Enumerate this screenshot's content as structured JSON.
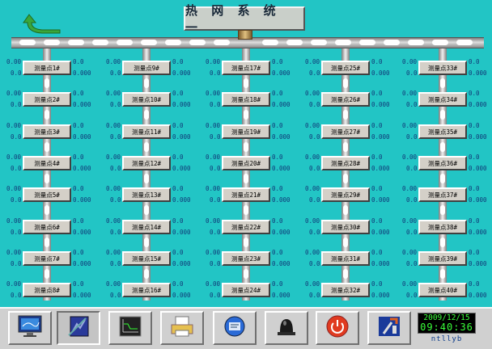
{
  "title": "热 网 系 统 一",
  "points": [
    {
      "label": "测量点1#",
      "tl": "0.00",
      "bl": "0.0",
      "tr": "0.0",
      "br": "0.000"
    },
    {
      "label": "测量点2#",
      "tl": "0.00",
      "bl": "0.0",
      "tr": "0.0",
      "br": "0.000"
    },
    {
      "label": "测量点3#",
      "tl": "0.00",
      "bl": "0.0",
      "tr": "0.0",
      "br": "0.000"
    },
    {
      "label": "测量点4#",
      "tl": "0.00",
      "bl": "0.0",
      "tr": "0.0",
      "br": "0.000"
    },
    {
      "label": "测量点5#",
      "tl": "0.00",
      "bl": "0.0",
      "tr": "0.0",
      "br": "0.000"
    },
    {
      "label": "测量点6#",
      "tl": "0.00",
      "bl": "0.0",
      "tr": "0.0",
      "br": "0.000"
    },
    {
      "label": "测量点7#",
      "tl": "0.00",
      "bl": "0.0",
      "tr": "0.0",
      "br": "0.000"
    },
    {
      "label": "测量点8#",
      "tl": "0.00",
      "bl": "0.0",
      "tr": "0.0",
      "br": "0.000"
    },
    {
      "label": "测量点9#",
      "tl": "0.00",
      "bl": "0.0",
      "tr": "0.0",
      "br": "0.000"
    },
    {
      "label": "测量点10#",
      "tl": "0.00",
      "bl": "0.0",
      "tr": "0.0",
      "br": "0.000"
    },
    {
      "label": "测量点11#",
      "tl": "0.00",
      "bl": "0.0",
      "tr": "0.0",
      "br": "0.000"
    },
    {
      "label": "测量点12#",
      "tl": "0.00",
      "bl": "0.0",
      "tr": "0.0",
      "br": "0.000"
    },
    {
      "label": "测量点13#",
      "tl": "0.00",
      "bl": "0.0",
      "tr": "0.0",
      "br": "0.000"
    },
    {
      "label": "测量点14#",
      "tl": "0.00",
      "bl": "0.0",
      "tr": "0.0",
      "br": "0.000"
    },
    {
      "label": "测量点15#",
      "tl": "0.00",
      "bl": "0.0",
      "tr": "0.0",
      "br": "0.000"
    },
    {
      "label": "测量点16#",
      "tl": "0.00",
      "bl": "0.0",
      "tr": "0.0",
      "br": "0.000"
    },
    {
      "label": "测量点17#",
      "tl": "0.00",
      "bl": "0.0",
      "tr": "0.0",
      "br": "0.000"
    },
    {
      "label": "测量点18#",
      "tl": "0.00",
      "bl": "0.0",
      "tr": "0.0",
      "br": "0.000"
    },
    {
      "label": "测量点19#",
      "tl": "0.00",
      "bl": "0.0",
      "tr": "0.0",
      "br": "0.000"
    },
    {
      "label": "测量点20#",
      "tl": "0.00",
      "bl": "0.0",
      "tr": "0.0",
      "br": "0.000"
    },
    {
      "label": "测量点21#",
      "tl": "0.00",
      "bl": "0.0",
      "tr": "0.0",
      "br": "0.000"
    },
    {
      "label": "测量点22#",
      "tl": "0.00",
      "bl": "0.0",
      "tr": "0.0",
      "br": "0.000"
    },
    {
      "label": "测量点23#",
      "tl": "0.00",
      "bl": "0.0",
      "tr": "0.0",
      "br": "0.000"
    },
    {
      "label": "测量点24#",
      "tl": "0.00",
      "bl": "0.0",
      "tr": "0.0",
      "br": "0.000"
    },
    {
      "label": "测量点25#",
      "tl": "0.00",
      "bl": "0.0",
      "tr": "0.0",
      "br": "0.000"
    },
    {
      "label": "测量点26#",
      "tl": "0.00",
      "bl": "0.0",
      "tr": "0.0",
      "br": "0.000"
    },
    {
      "label": "测量点27#",
      "tl": "0.00",
      "bl": "0.0",
      "tr": "0.0",
      "br": "0.000"
    },
    {
      "label": "测量点28#",
      "tl": "0.00",
      "bl": "0.0",
      "tr": "0.0",
      "br": "0.000"
    },
    {
      "label": "测量点29#",
      "tl": "0.00",
      "bl": "0.0",
      "tr": "0.0",
      "br": "0.000"
    },
    {
      "label": "测量点30#",
      "tl": "0.00",
      "bl": "0.0",
      "tr": "0.0",
      "br": "0.000"
    },
    {
      "label": "测量点31#",
      "tl": "0.00",
      "bl": "0.0",
      "tr": "0.0",
      "br": "0.000"
    },
    {
      "label": "测量点32#",
      "tl": "0.00",
      "bl": "0.0",
      "tr": "0.0",
      "br": "0.000"
    },
    {
      "label": "测量点33#",
      "tl": "0.00",
      "bl": "0.0",
      "tr": "0.0",
      "br": "0.000"
    },
    {
      "label": "测量点34#",
      "tl": "0.00",
      "bl": "0.0",
      "tr": "0.0",
      "br": "0.000"
    },
    {
      "label": "测量点35#",
      "tl": "0.00",
      "bl": "0.0",
      "tr": "0.0",
      "br": "0.000"
    },
    {
      "label": "测量点36#",
      "tl": "0.00",
      "bl": "0.0",
      "tr": "0.0",
      "br": "0.000"
    },
    {
      "label": "测量点37#",
      "tl": "0.00",
      "bl": "0.0",
      "tr": "0.0",
      "br": "0.000"
    },
    {
      "label": "测量点38#",
      "tl": "0.00",
      "bl": "0.0",
      "tr": "0.0",
      "br": "0.000"
    },
    {
      "label": "测量点39#",
      "tl": "0.00",
      "bl": "0.0",
      "tr": "0.0",
      "br": "0.000"
    },
    {
      "label": "测量点40#",
      "tl": "0.00",
      "bl": "0.0",
      "tr": "0.0",
      "br": "0.000"
    }
  ],
  "taskbar": {
    "buttons": [
      {
        "name": "monitor-icon",
        "pressed": false
      },
      {
        "name": "trend-notebook-icon",
        "pressed": true
      },
      {
        "name": "curve-chart-icon",
        "pressed": false
      },
      {
        "name": "printer-report-icon",
        "pressed": false
      },
      {
        "name": "network-globe-icon",
        "pressed": false
      },
      {
        "name": "alarm-bell-icon",
        "pressed": false
      },
      {
        "name": "power-icon",
        "pressed": false
      },
      {
        "name": "tools-icon",
        "pressed": false
      }
    ],
    "date": "2009/12/15",
    "time": "09:40:36",
    "user": "ntllyb"
  },
  "colors": {
    "background": "#22c5c5",
    "value_text": "#123a78",
    "clock_text": "#3aff3a"
  }
}
